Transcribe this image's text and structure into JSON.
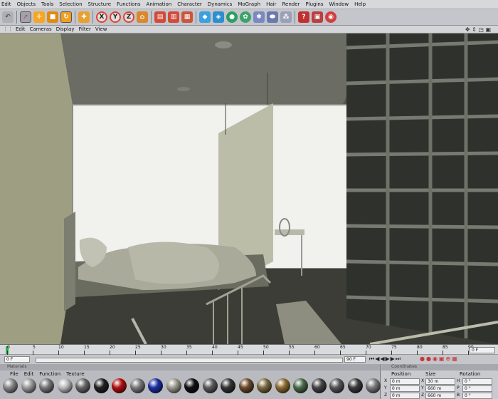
{
  "menus": [
    "Edit",
    "Objects",
    "Tools",
    "Selection",
    "Structure",
    "Functions",
    "Animation",
    "Character",
    "Dynamics",
    "MoGraph",
    "Hair",
    "Render",
    "Plugins",
    "Window",
    "Help"
  ],
  "toolbar_icons": [
    "undo-icon",
    "live-select-icon",
    "move-icon",
    "scale-icon",
    "rotate-icon",
    "add-tool-icon",
    "x-axis-icon",
    "y-axis-icon",
    "z-axis-icon",
    "coordinate-system-icon",
    "render-view-icon",
    "render-picture-viewer-icon",
    "render-settings-icon",
    "cube-primitive-icon",
    "spline-icon",
    "nurbs-icon",
    "array-icon",
    "deformer-icon",
    "scene-icon",
    "camera-icon",
    "light-icon",
    "tag-icon",
    "display-icon"
  ],
  "axis_letters": {
    "x": "X",
    "y": "Y",
    "z": "Z"
  },
  "viewport_menu": [
    "Edit",
    "Cameras",
    "Display",
    "Filter",
    "View"
  ],
  "timeline": {
    "ticks": [
      "0",
      "5",
      "10",
      "15",
      "20",
      "25",
      "30",
      "35",
      "40",
      "45",
      "50",
      "55",
      "60",
      "65",
      "70",
      "75",
      "80",
      "85",
      "90"
    ],
    "current_frame_end": "0 F",
    "start_field": "0 F",
    "end_field": "90 F"
  },
  "materials": {
    "title": "Materials",
    "menu": [
      "File",
      "Edit",
      "Function",
      "Texture"
    ],
    "swatch_colors": [
      "#888",
      "#9a9a9a",
      "#777",
      "#bbb",
      "#666",
      "#222",
      "#b01010",
      "#7a7a7a",
      "#1c2fa0",
      "#9c9a8c",
      "#111",
      "#5a5a5a",
      "#333",
      "#6a4a2a",
      "#7a6a40",
      "#8a6a30",
      "#4a6a4a",
      "#444",
      "#555",
      "#3a3a3a",
      "#7a7a7a"
    ]
  },
  "coordinates": {
    "title": "Coordinates",
    "headers": [
      "Position",
      "Size",
      "Rotation"
    ],
    "rows": [
      {
        "axis": "X",
        "pos": "0 m",
        "size": "30 m",
        "rot_label": "H",
        "rot": "0 °"
      },
      {
        "axis": "Y",
        "pos": "0 m",
        "size": "660 m",
        "rot_label": "P",
        "rot": "0 °"
      },
      {
        "axis": "Z",
        "pos": "0 m",
        "size": "660 m",
        "rot_label": "B",
        "rot": "0 °"
      }
    ]
  }
}
